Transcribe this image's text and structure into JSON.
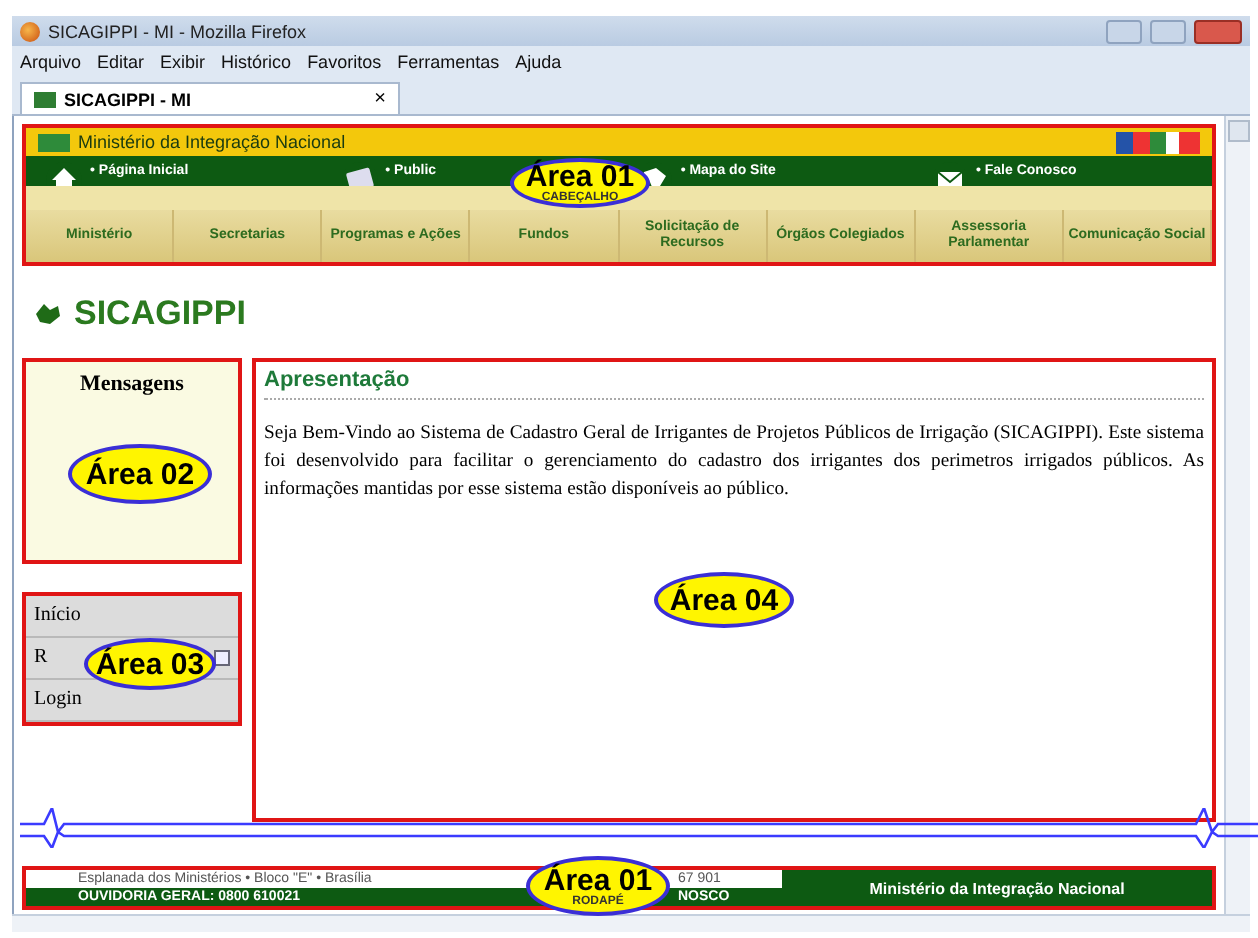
{
  "browser": {
    "title": "SICAGIPPI - MI - Mozilla Firefox",
    "menu": [
      "Arquivo",
      "Editar",
      "Exibir",
      "Histórico",
      "Favoritos",
      "Ferramentas",
      "Ajuda"
    ],
    "tab": {
      "label": "SICAGIPPI - MI",
      "close": "×",
      "selected": true
    }
  },
  "header": {
    "ministry": "Ministério da Integração Nacional",
    "quick_links": [
      "• Página Inicial",
      "• Public",
      "• Mapa do Site",
      "• Fale Conosco"
    ],
    "nav": [
      "Ministério",
      "Secretarias",
      "Programas e Ações",
      "Fundos",
      "Solicitação de Recursos",
      "Órgãos Colegiados",
      "Assessoria Parlamentar",
      "Comunicação Social"
    ]
  },
  "page_title": "SICAGIPPI",
  "messages": {
    "title": "Mensagens"
  },
  "side_menu": [
    "Início",
    "R",
    "Login"
  ],
  "content": {
    "title": "Apresentação",
    "text": "Seja Bem-Vindo ao Sistema de Cadastro Geral de Irrigantes de Projetos Públicos de Irrigação (SICAGIPPI). Este sistema foi desenvolvido para facilitar o gerenciamento do cadastro dos irrigantes dos perimetros irrigados públicos. As informações mantidas por esse sistema estão disponíveis ao público."
  },
  "footer": {
    "address": "Esplanada dos Ministérios • Bloco \"E\" • Brasília",
    "address_end": "67 901",
    "ouvidoria": "OUVIDORIA GERAL: 0800 610021",
    "contact_end": "NOSCO",
    "brand": "Ministério da Integração Nacional"
  },
  "annotations": [
    {
      "label": "Área 01",
      "sublabel": "CABEÇALHO"
    },
    {
      "label": "Área 02"
    },
    {
      "label": "Área 03"
    },
    {
      "label": "Área 04"
    },
    {
      "label": "Área 01",
      "sublabel": "RODAPÉ"
    }
  ]
}
